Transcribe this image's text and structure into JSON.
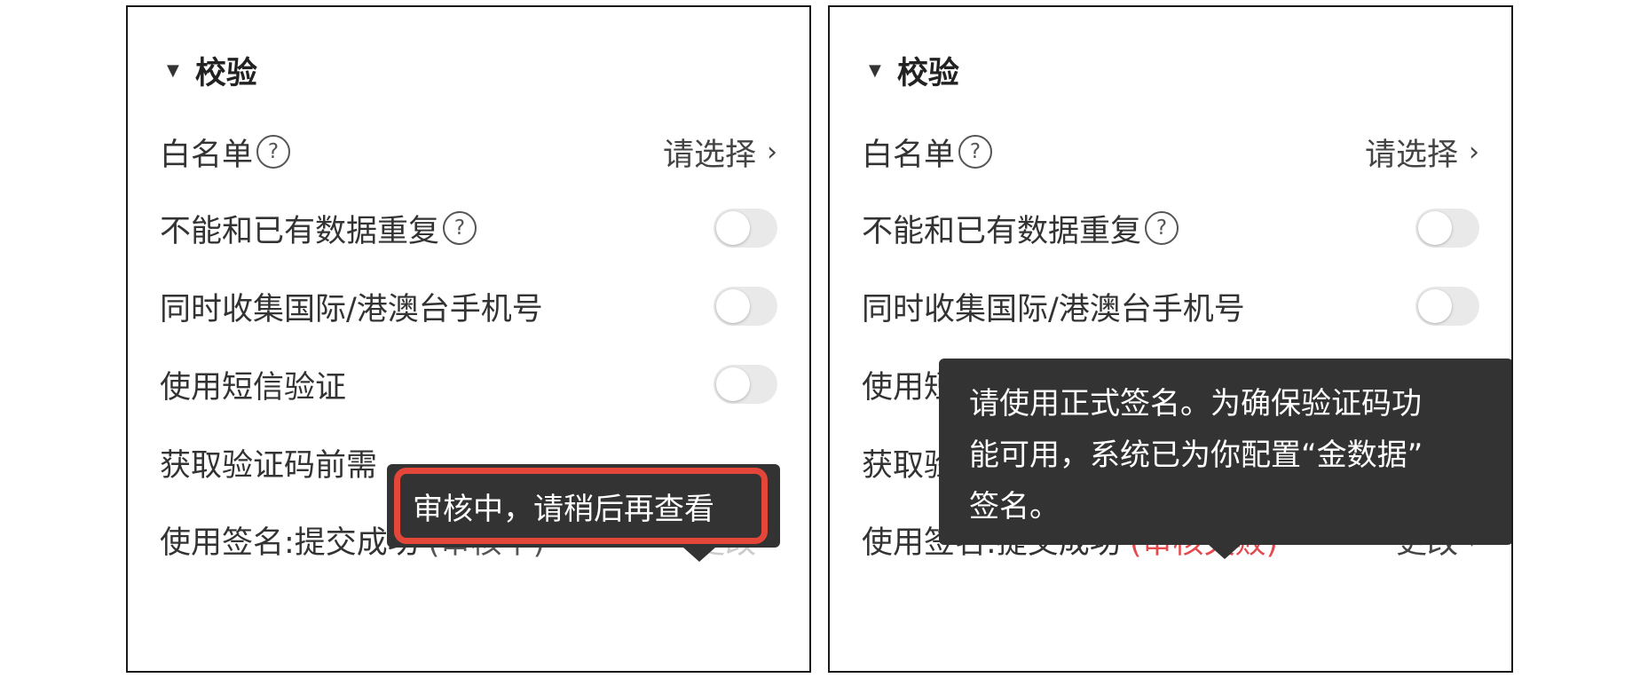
{
  "left_panel": {
    "section_title": "校验",
    "whitelist": {
      "label": "白名单",
      "help": "?",
      "value": "请选择",
      "chevron": "›"
    },
    "no_duplicate": {
      "label": "不能和已有数据重复",
      "help": "?",
      "enabled": false
    },
    "intl_phone": {
      "label": "同时收集国际/港澳台手机号",
      "enabled": false
    },
    "sms_verify": {
      "label": "使用短信验证",
      "enabled": false
    },
    "captcha": {
      "label": "获取验证码前需"
    },
    "signature": {
      "label": "使用签名: ",
      "value": "提交成功",
      "status": "(审核中)",
      "action": "更改",
      "chevron": "›"
    },
    "tooltip": {
      "text": "审核中，请稍后再查看"
    }
  },
  "right_panel": {
    "section_title": "校验",
    "whitelist": {
      "label": "白名单",
      "help": "?",
      "value": "请选择",
      "chevron": "›"
    },
    "no_duplicate": {
      "label": "不能和已有数据重复",
      "help": "?",
      "enabled": false
    },
    "intl_phone": {
      "label": "同时收集国际/港澳台手机号",
      "enabled": false
    },
    "sms_verify": {
      "label": "使用短信验证",
      "enabled": false
    },
    "captcha": {
      "label": "获取验证码前需"
    },
    "signature": {
      "label": "使用签名: ",
      "value": "提交成功",
      "status": "(审核失败)",
      "action": "更改",
      "chevron": "›"
    },
    "tooltip": {
      "text_line1": "请使用正式签名。为确保验证码功",
      "text_line2": "能可用，系统已为你配置“金数据”",
      "text_line3": "签名。"
    }
  },
  "colors": {
    "highlight_border": "#e5463a",
    "status_failed": "#e5484d",
    "tooltip_bg": "#333333",
    "toggle_off": "#e9e9e9"
  }
}
